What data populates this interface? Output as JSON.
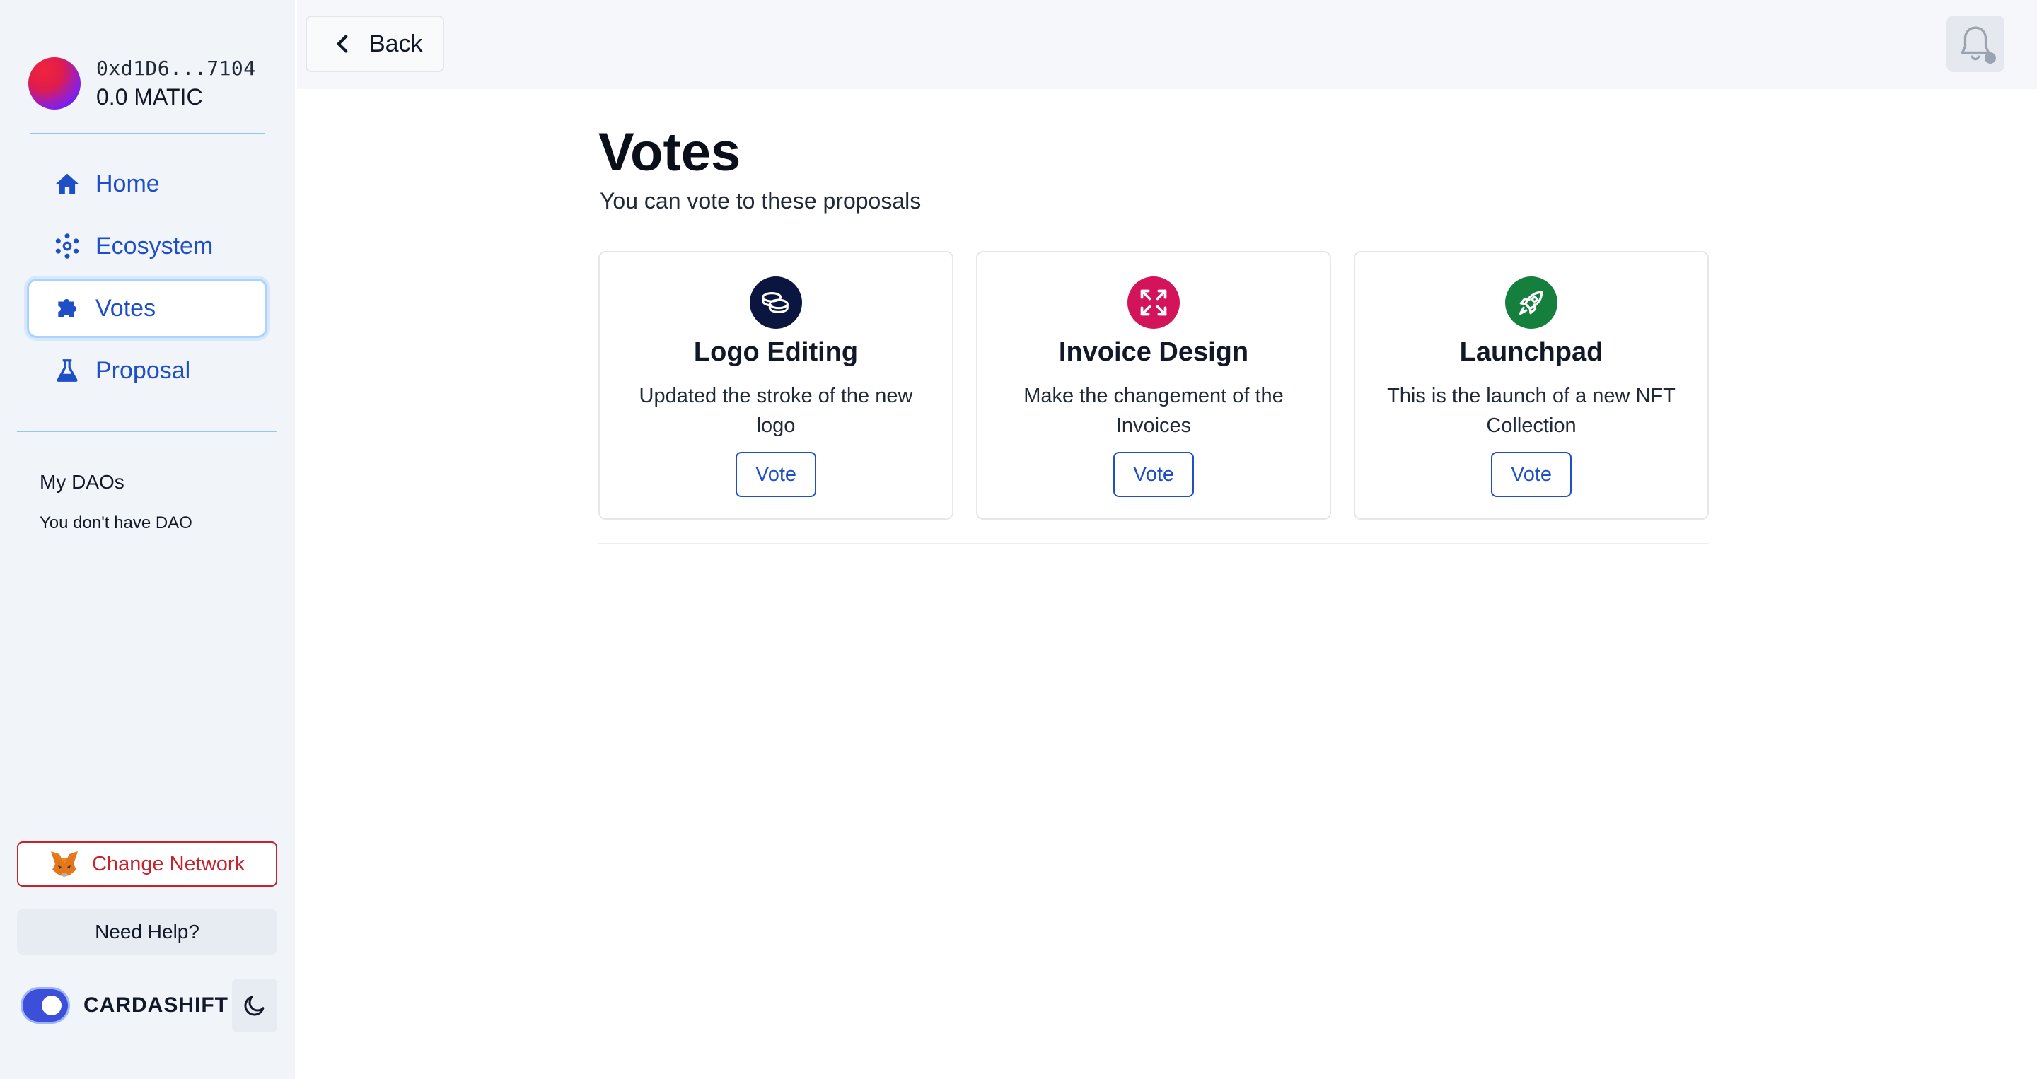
{
  "account": {
    "address": "0xd1D6...7104",
    "balance": "0.0 MATIC"
  },
  "sidebar": {
    "nav": [
      {
        "label": "Home",
        "icon": "home-icon"
      },
      {
        "label": "Ecosystem",
        "icon": "ecosystem-icon"
      },
      {
        "label": "Votes",
        "icon": "puzzle-icon",
        "active": true
      },
      {
        "label": "Proposal",
        "icon": "flask-icon"
      }
    ],
    "my_daos_title": "My DAOs",
    "my_daos_empty": "You don't have DAO",
    "change_network_label": "Change Network",
    "need_help_label": "Need Help?",
    "brand": "CARDASHIFT"
  },
  "topbar": {
    "back_label": "Back"
  },
  "main": {
    "title": "Votes",
    "subtitle": "You can vote to these proposals",
    "cards": [
      {
        "title": "Logo Editing",
        "description": "Updated the stroke of the new logo",
        "vote_label": "Vote",
        "icon": "coins-icon",
        "icon_color": "#0b1640"
      },
      {
        "title": "Invoice Design",
        "description": "Make the changement of the Invoices",
        "vote_label": "Vote",
        "icon": "expand-icon",
        "icon_color": "#d3145a"
      },
      {
        "title": "Launchpad",
        "description": "This is the launch of a new NFT Collection",
        "vote_label": "Vote",
        "icon": "rocket-icon",
        "icon_color": "#15803d"
      }
    ]
  },
  "colors": {
    "accent": "#1e4fc7",
    "danger": "#c8232d",
    "sidebar_bg": "#f1f4f8"
  }
}
